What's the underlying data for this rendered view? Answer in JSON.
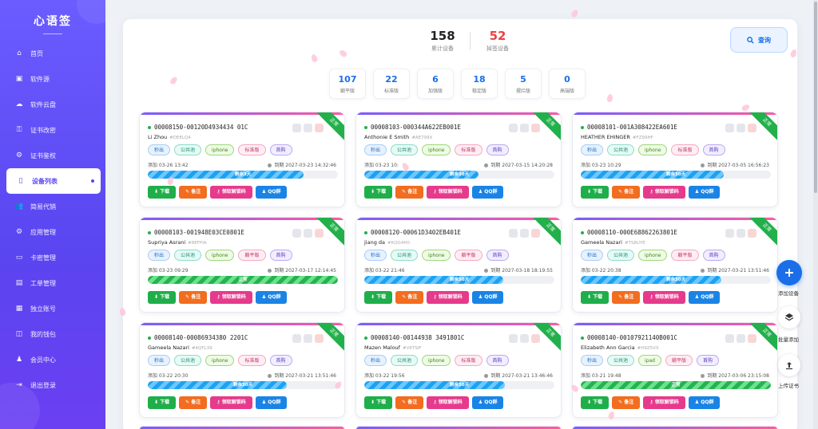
{
  "sidebar": {
    "brand": "心语签",
    "items": [
      {
        "label": "首页",
        "icon": "home-icon",
        "glyph": "⌂"
      },
      {
        "label": "软件源",
        "icon": "box-icon",
        "glyph": "▣"
      },
      {
        "label": "软件云盘",
        "icon": "cloud-icon",
        "glyph": "☁"
      },
      {
        "label": "证书改密",
        "icon": "key-icon",
        "glyph": "⚿"
      },
      {
        "label": "证书鉴权",
        "icon": "gear-icon",
        "glyph": "⚙"
      },
      {
        "label": "设备列表",
        "icon": "phone-icon",
        "glyph": "▯",
        "active": true
      },
      {
        "label": "简易代销",
        "icon": "users-icon",
        "glyph": "👥"
      },
      {
        "label": "应用管理",
        "icon": "apps-icon",
        "glyph": "⚙"
      },
      {
        "label": "卡密管理",
        "icon": "card-icon",
        "glyph": "▭"
      },
      {
        "label": "工单管理",
        "icon": "ticket-icon",
        "glyph": "▤"
      },
      {
        "label": "独立账号",
        "icon": "account-icon",
        "glyph": "▦"
      },
      {
        "label": "我的钱包",
        "icon": "wallet-icon",
        "glyph": "◫"
      },
      {
        "label": "会员中心",
        "icon": "member-icon",
        "glyph": "♟"
      },
      {
        "label": "退出登录",
        "icon": "logout-icon",
        "glyph": "⇥"
      }
    ]
  },
  "summary": {
    "total_value": "158",
    "total_label": "累计设备",
    "dropped_value": "52",
    "dropped_label": "掉签设备",
    "query_label": "查询"
  },
  "stats": [
    {
      "value": "107",
      "label": "躺平版"
    },
    {
      "value": "22",
      "label": "标准版"
    },
    {
      "value": "6",
      "label": "加强版"
    },
    {
      "value": "18",
      "label": "稳定版"
    },
    {
      "value": "5",
      "label": "摆烂版"
    },
    {
      "value": "0",
      "label": "高端版"
    }
  ],
  "card_buttons": {
    "download": "下载",
    "note": "备注",
    "unlock": "领取解锁码",
    "qq": "QQ群"
  },
  "status_ribbon": "正常",
  "cards": [
    {
      "sn": "00008150-00120D4934434 01C",
      "owner": "Li Zhou",
      "code": "#DEELQ4",
      "tags": [
        "秒出",
        "公共池",
        "iphone",
        "标准版",
        "首购"
      ],
      "add": "添加 03-26 13:42",
      "exp": "到期 2027-03-23 14:32:46",
      "progress": 0.82,
      "bar_text": "剩余3天",
      "green": false
    },
    {
      "sn": "00008103-000344A622EB001E",
      "owner": "Anthonie E Smith",
      "code": "#AE799X",
      "tags": [
        "秒出",
        "公共池",
        "iphone",
        "标准版",
        "首购"
      ],
      "add": "添加 03-23 10:",
      "exp": "到期 2027-03-15 14:20:28",
      "progress": 0.6,
      "bar_text": "剩余30天",
      "green": false
    },
    {
      "sn": "00008101-001A308422EA601E",
      "owner": "HEATHER EHINGER",
      "code": "#FZ99HF",
      "tags": [
        "秒出",
        "公共池",
        "iphone",
        "标准版",
        "首购"
      ],
      "add": "添加 03-23 10:29",
      "exp": "到期 2027-03-05 16:56:23",
      "progress": 0.75,
      "bar_text": "剩余30天",
      "green": false
    },
    {
      "sn": "00008103-001948E03CE0801E",
      "owner": "Supriya Asrani",
      "code": "#8EFPIA",
      "tags": [
        "秒出",
        "公共池",
        "iphone",
        "躺平版",
        "首购"
      ],
      "add": "添加 03-23 09:29",
      "exp": "到期 2027-03-17 12:14:45",
      "progress": 1,
      "bar_text": "正常",
      "green": true
    },
    {
      "sn": "00008120-00061D3402EB401E",
      "owner": "jiang da",
      "code": "#KQG4H0",
      "tags": [
        "秒出",
        "公共池",
        "iphone",
        "躺平版",
        "首购"
      ],
      "add": "添加 03-22 21:46",
      "exp": "到期 2027-03-18 18:19:55",
      "progress": 0.73,
      "bar_text": "剩余30天",
      "green": false
    },
    {
      "sn": "00008110-000E68862263801E",
      "owner": "Gameela Nazari",
      "code": "#TS8UYE",
      "tags": [
        "秒出",
        "公共池",
        "iphone",
        "躺平版",
        "首购"
      ],
      "add": "添加 03-22 20:38",
      "exp": "到期 2027-03-21 13:51:46",
      "progress": 0.74,
      "bar_text": "剩余30天",
      "green": false
    },
    {
      "sn": "00008140-00086934380 2201C",
      "owner": "Gameela Nazari",
      "code": "#4QFL39",
      "tags": [
        "秒出",
        "公共池",
        "iphone",
        "标准版",
        "首购"
      ],
      "add": "添加 03-22 20:30",
      "exp": "到期 2027-03-21 13:51:46",
      "progress": 0.73,
      "bar_text": "剩余30天",
      "green": false
    },
    {
      "sn": "00008140-00144938 3491801C",
      "owner": "Mazen Malouf",
      "code": "#V6TSIF",
      "tags": [
        "秒出",
        "公共池",
        "iphone",
        "标准版",
        "首购"
      ],
      "add": "添加 03-22 19:56",
      "exp": "到期 2027-03-21 13:46:46",
      "progress": 0.74,
      "bar_text": "剩余30天",
      "green": false
    },
    {
      "sn": "00008140-00107921140B001C",
      "owner": "Elizabeth Ann Garcia",
      "code": "#H9Z5VX",
      "tags": [
        "秒出",
        "公共池",
        "ipad",
        "躺平版",
        "首购"
      ],
      "add": "添加 03-21 19:48",
      "exp": "到期 2027-03-06 23:15:08",
      "progress": 1,
      "bar_text": "正常",
      "green": true
    }
  ],
  "side_actions": [
    {
      "label": "添加设备",
      "icon": "plus-icon"
    },
    {
      "label": "批量添加",
      "icon": "layers-icon"
    },
    {
      "label": "上传证书",
      "icon": "upload-icon"
    }
  ],
  "colors": {
    "accent": "#5a45f0",
    "primary_blue": "#1a6fe8",
    "danger": "#f04040",
    "success": "#22b04b"
  }
}
